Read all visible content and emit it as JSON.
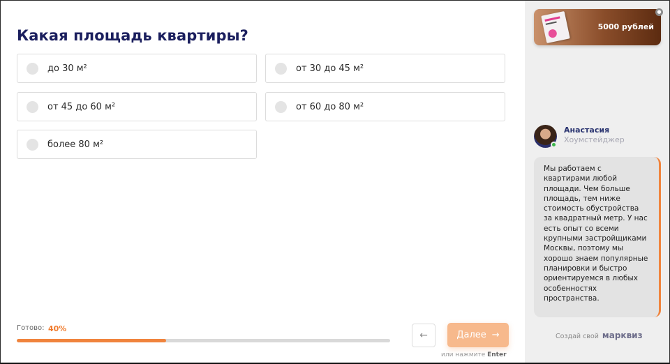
{
  "quiz": {
    "question": "Какая площадь квартиры?",
    "options": [
      {
        "label": "до 30 м²"
      },
      {
        "label": "от 30 до 45 м²"
      },
      {
        "label": "от 45 до 60 м²"
      },
      {
        "label": "от 60 до 80 м²"
      },
      {
        "label": "более 80 м²"
      }
    ]
  },
  "progress": {
    "label": "Готово:",
    "value_text": "40%",
    "fraction": 0.4
  },
  "nav": {
    "back_icon": "arrow-left-icon",
    "next_label": "Далее",
    "next_arrow": "→",
    "back_arrow": "←",
    "hint_prefix": "или нажмите",
    "hint_key": "Enter"
  },
  "sidebar": {
    "promo_price": "5000 рублей",
    "lock_icon": "lock-icon",
    "agent_name": "Анастасия",
    "agent_role": "Хоумстейджер",
    "message": "Мы работаем с квартирами любой площади. Чем больше площадь, тем ниже стоимость обустройства за квадратный метр. У нас есть опыт со всеми крупными застройщиками Москвы, поэтому мы хорошо знаем популярные планировки и быстро ориентируемся в любых особенностях пространства.",
    "brand_prefix": "Создай свой",
    "brand_name": "марквиз"
  },
  "colors": {
    "accent": "#f0843d",
    "title": "#1b1f5e",
    "next_button": "#f7b98c",
    "online": "#3bb54a"
  }
}
